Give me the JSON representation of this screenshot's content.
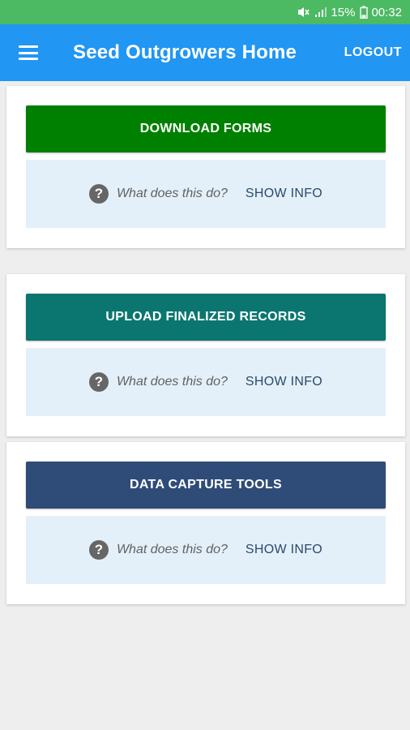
{
  "status_bar": {
    "battery_percent": "15%",
    "time": "00:32",
    "color": "#4cb963"
  },
  "app_bar": {
    "title": "Seed Outgrowers Home",
    "logout_label": "LOGOUT",
    "color": "#2196f3"
  },
  "cards": [
    {
      "button_label": "DOWNLOAD FORMS",
      "button_color": "#008000",
      "question": "What does this do?",
      "show_info_label": "SHOW INFO"
    },
    {
      "button_label": "UPLOAD FINALIZED RECORDS",
      "button_color": "#0b7670",
      "question": "What does this do?",
      "show_info_label": "SHOW INFO"
    },
    {
      "button_label": "DATA CAPTURE TOOLS",
      "button_color": "#2f4b78",
      "question": "What does this do?",
      "show_info_label": "SHOW INFO"
    }
  ],
  "icons": {
    "menu": "hamburger-menu-icon",
    "help": "question-circle-icon",
    "mute": "mute-icon",
    "signal": "signal-icon",
    "battery": "battery-icon"
  }
}
